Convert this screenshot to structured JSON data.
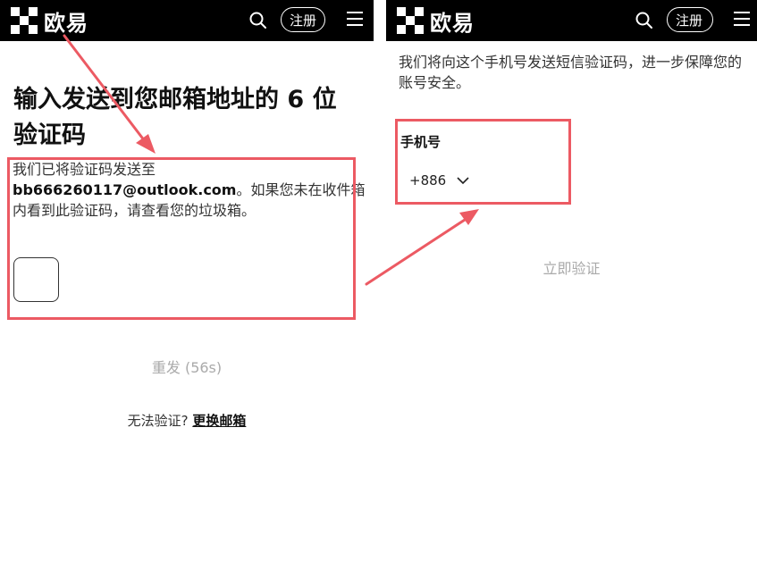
{
  "left": {
    "brand": "欧易",
    "signup": "注册",
    "title": "输入发送到您邮箱地址的 6 位验证码",
    "desc_prefix": "我们已将验证码发送至",
    "email": "bb666260117@outlook.com",
    "desc_suffix": "。如果您未在收件箱内看到此验证码，请查看您的垃圾箱。",
    "resend": "重发 (56s)",
    "cannot_verify": "无法验证?",
    "change_email": "更换邮箱"
  },
  "right": {
    "brand": "欧易",
    "signup": "注册",
    "desc": "我们将向这个手机号发送短信验证码，进一步保障您的账号安全。",
    "phone_label": "手机号",
    "country_code": "+886",
    "verify_button": "立即验证"
  },
  "colors": {
    "topbar": "#000000",
    "highlight": "#ec5a63",
    "muted_text": "#aaaaaa"
  },
  "icons": {
    "logo": "okx-logo-icon",
    "search": "search-icon",
    "menu": "hamburger-menu-icon",
    "dropdown": "chevron-down-icon"
  }
}
